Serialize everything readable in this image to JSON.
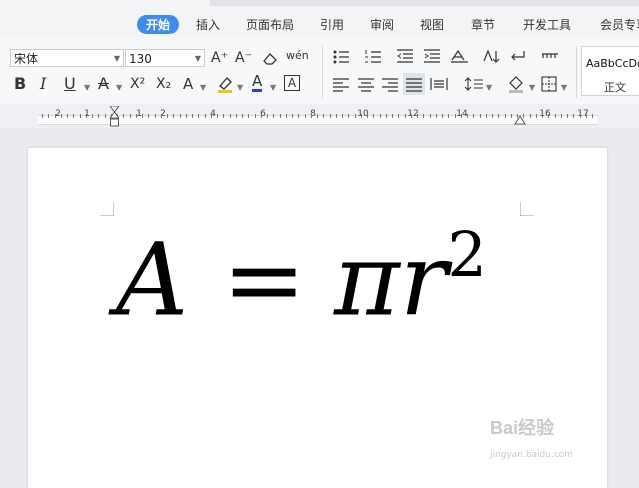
{
  "ribbon_tabs": [
    {
      "label": "开始",
      "active": true
    },
    {
      "label": "插入"
    },
    {
      "label": "页面布局"
    },
    {
      "label": "引用"
    },
    {
      "label": "审阅"
    },
    {
      "label": "视图"
    },
    {
      "label": "章节"
    },
    {
      "label": "开发工具"
    },
    {
      "label": "会员专享"
    }
  ],
  "font": {
    "name": "宋体",
    "size": "130"
  },
  "buttons": {
    "bold": "B",
    "italic": "I",
    "underline": "U",
    "strike": "A",
    "superscript": "X²",
    "subscript": "X₂",
    "char_effect": "A",
    "font_color": "A",
    "char_border": "A",
    "grow": "A⁺",
    "shrink": "A⁻",
    "pinyin": "wén"
  },
  "styles": {
    "sample": "AaBbCcDd",
    "name": "正文"
  },
  "ruler": {
    "numbers": [
      "2",
      "1",
      "1",
      "2",
      "4",
      "6",
      "8",
      "10",
      "12",
      "14",
      "16",
      "17"
    ]
  },
  "document": {
    "formula": {
      "lhs": "A",
      "eq": "=",
      "rhs": "πr",
      "exp": "2"
    }
  },
  "watermark": {
    "logo": "Bai经验",
    "site": "jingyan.baidu.com"
  },
  "colors": {
    "accent": "#3f8cf0",
    "page": "#ffffff",
    "font_color_bar": "#2b3fd1",
    "highlight_bar": "#f0c419"
  }
}
